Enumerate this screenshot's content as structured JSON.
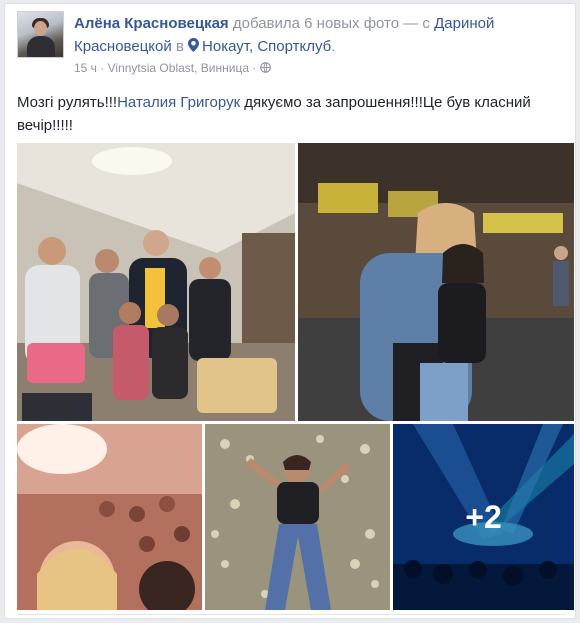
{
  "post": {
    "author": "Алёна Красновецкая",
    "action": " добавила 6 новых фото — с ",
    "tagged": "Дариной Красновецкой",
    "at": " в ",
    "place": "Нокаут, Спортклуб",
    "period": ".",
    "time": "15 ч",
    "location": "Vinnytsia Oblast, Винница",
    "sep": "·",
    "text_part1": "Мозгі рулять!!!",
    "text_mention": "Наталия Григорук",
    "text_part2": " дякуємо за запрошення!!!Це був класний вечір!!!!!",
    "more_photos": "+2"
  },
  "colors": {
    "link": "#365899",
    "meta": "#90949c",
    "text": "#1d2129",
    "background": "#e9ebee"
  },
  "icons": {
    "pin": "location-pin-icon",
    "privacy": "globe-icon"
  }
}
